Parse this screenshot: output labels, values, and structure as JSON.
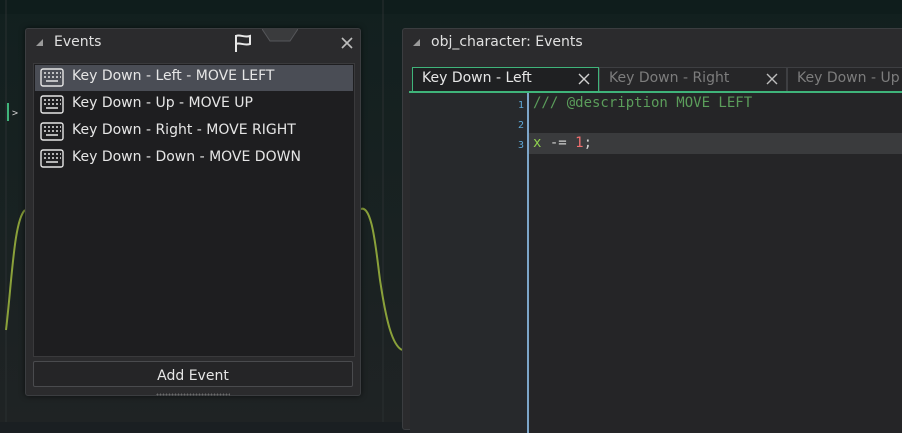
{
  "events_panel": {
    "title": "Events",
    "items": [
      {
        "label": "Key Down - Left - MOVE LEFT",
        "selected": true
      },
      {
        "label": "Key Down - Up - MOVE UP",
        "selected": false
      },
      {
        "label": "Key Down - Right - MOVE RIGHT",
        "selected": false
      },
      {
        "label": "Key Down - Down - MOVE DOWN",
        "selected": false
      }
    ],
    "add_button_label": "Add Event"
  },
  "editor_panel": {
    "title": "obj_character: Events",
    "tabs": [
      {
        "label": "Key Down - Left",
        "active": true
      },
      {
        "label": "Key Down - Right",
        "active": false
      },
      {
        "label": "Key Down - Up",
        "active": false
      }
    ],
    "line_numbers": [
      "1",
      "2",
      "3"
    ],
    "code": {
      "line1_comment": "/// @description MOVE LEFT",
      "line3_var": "x",
      "line3_op": " -= ",
      "line3_num": "1",
      "line3_end": ";"
    },
    "fold_marker": ">"
  },
  "colors": {
    "accent_green": "#3fb47a",
    "comment": "#5b9d5b",
    "number": "#f07070",
    "variable": "#8fd14f",
    "line_number": "#5fa8d6"
  }
}
